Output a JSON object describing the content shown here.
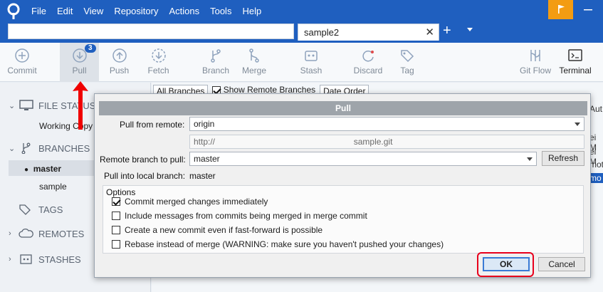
{
  "menu": [
    "File",
    "Edit",
    "View",
    "Repository",
    "Actions",
    "Tools",
    "Help"
  ],
  "tabs": {
    "active_label": "sample2",
    "close": "✕",
    "new_tab": "+"
  },
  "toolbar": [
    {
      "key": "commit",
      "label": "Commit",
      "icon": "plus-circle-icon"
    },
    {
      "key": "pull",
      "label": "Pull",
      "icon": "arrow-down-circle-icon",
      "badge": "3"
    },
    {
      "key": "push",
      "label": "Push",
      "icon": "arrow-up-circle-icon"
    },
    {
      "key": "fetch",
      "label": "Fetch",
      "icon": "fetch-icon"
    },
    {
      "key": "branch",
      "label": "Branch",
      "icon": "branch-icon"
    },
    {
      "key": "merge",
      "label": "Merge",
      "icon": "merge-icon"
    },
    {
      "key": "stash",
      "label": "Stash",
      "icon": "stash-icon"
    },
    {
      "key": "discard",
      "label": "Discard",
      "icon": "discard-icon"
    },
    {
      "key": "tag",
      "label": "Tag",
      "icon": "tag-icon"
    },
    {
      "key": "gitflow",
      "label": "Git Flow",
      "icon": "git-flow-icon"
    },
    {
      "key": "terminal",
      "label": "Terminal",
      "icon": "terminal-icon"
    }
  ],
  "sidebar": {
    "file_status": "FILE STATUS",
    "working_copy": "Working Copy",
    "branches": "BRANCHES",
    "branch_items": [
      "master",
      "sample"
    ],
    "tags": "TAGS",
    "remotes": "REMOTES",
    "stashes": "STASHES"
  },
  "filters": {
    "branches": "All Branches",
    "show_remote": "Show Remote Branches",
    "order": "Date Order"
  },
  "right_fragments": [
    "Aut",
    "ei M",
    "ei M",
    "mot",
    "mo"
  ],
  "dialog": {
    "title": "Pull",
    "pull_from_remote_label": "Pull from remote:",
    "remote_value": "origin",
    "remote_url_prefix": "http://",
    "remote_url_suffix": "sample.git",
    "remote_branch_label": "Remote branch to pull:",
    "remote_branch_value": "master",
    "refresh": "Refresh",
    "local_branch_label": "Pull into local branch:",
    "local_branch_value": "master",
    "options_label": "Options",
    "options": [
      {
        "label": "Commit merged changes immediately",
        "checked": true
      },
      {
        "label": "Include messages from commits being merged in merge commit",
        "checked": false
      },
      {
        "label": "Create a new commit even if fast-forward is possible",
        "checked": false
      },
      {
        "label": "Rebase instead of merge (WARNING: make sure you haven't pushed your changes)",
        "checked": false
      }
    ],
    "ok": "OK",
    "cancel": "Cancel"
  }
}
